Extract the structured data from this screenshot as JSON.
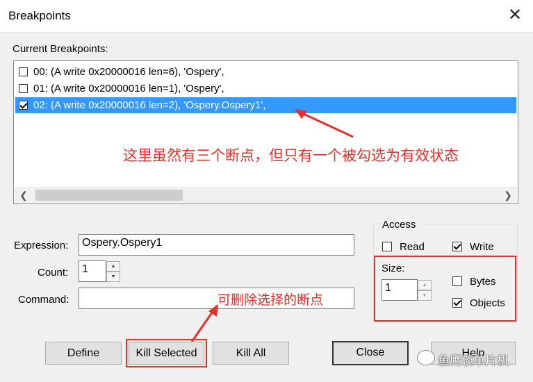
{
  "window": {
    "title": "Breakpoints"
  },
  "labels": {
    "current_breakpoints": "Current Breakpoints:",
    "expression": "Expression:",
    "count": "Count:",
    "command": "Command:",
    "access": "Access",
    "size": "Size:",
    "read": "Read",
    "write": "Write",
    "bytes": "Bytes",
    "objects": "Objects"
  },
  "breakpoints": [
    {
      "text": "00: (A write 0x20000016 len=6),  'Ospery',",
      "checked": false,
      "selected": false
    },
    {
      "text": "01: (A write 0x20000016 len=1),  'Ospery',",
      "checked": false,
      "selected": false
    },
    {
      "text": "02: (A write 0x20000016 len=2),  'Ospery.Ospery1',",
      "checked": true,
      "selected": true
    }
  ],
  "fields": {
    "expression_value": "Ospery.Ospery1",
    "count_value": "1",
    "command_value": "",
    "size_value": "1"
  },
  "checks": {
    "read": false,
    "write": true,
    "bytes": false,
    "objects": true
  },
  "buttons": {
    "define": "Define",
    "kill_selected": "Kill Selected",
    "kill_all": "Kill All",
    "close": "Close",
    "help": "Help"
  },
  "annotations": {
    "list_note": "这里虽然有三个断点，但只有一个被勾选为有效状态",
    "kill_note": "可删除选择的断点"
  },
  "watermark": "鱼鹰谈单片机",
  "colors": {
    "selection": "#3399ff",
    "annotation": "#e8302a"
  }
}
